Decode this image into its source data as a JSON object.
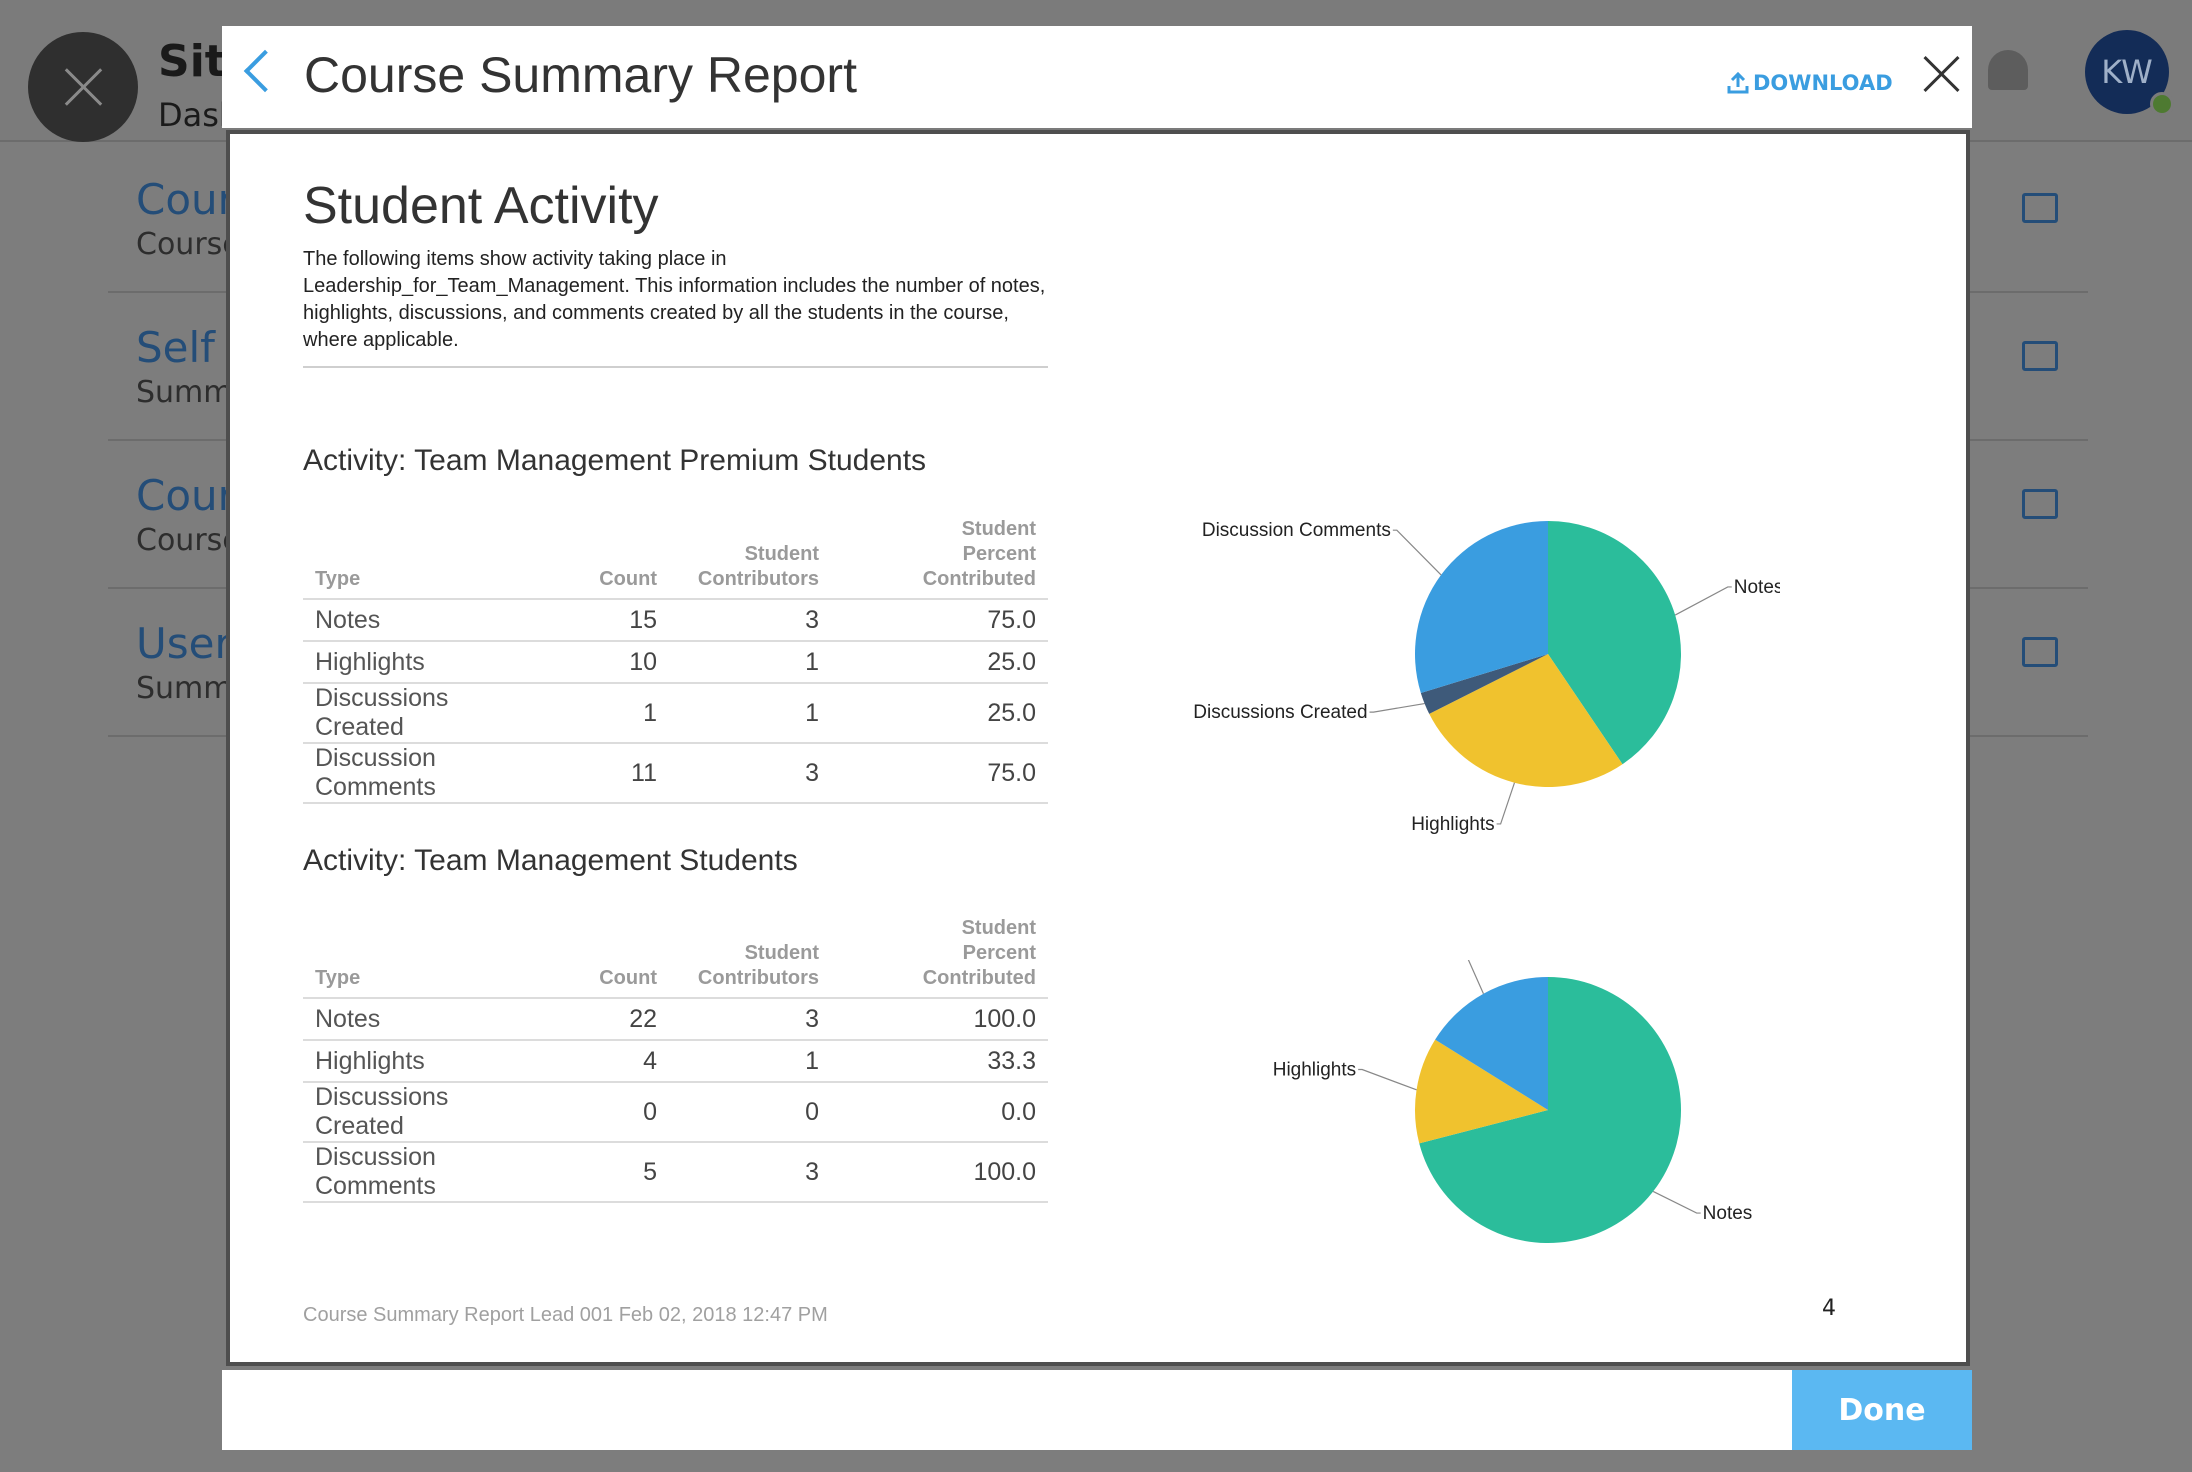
{
  "background": {
    "header_title": "Site",
    "header_subtitle": "Dash",
    "avatar_initials": "KW",
    "rows": [
      {
        "title": "Cour",
        "subtitle": "Course"
      },
      {
        "title": "Self /",
        "subtitle": "Summ"
      },
      {
        "title": "Cour",
        "subtitle": "Course"
      },
      {
        "title": "User",
        "subtitle": "Summ"
      }
    ]
  },
  "modal": {
    "title": "Course Summary Report",
    "download_label": "DOWNLOAD",
    "done_label": "Done"
  },
  "report": {
    "section_title": "Student Activity",
    "intro": "The following items show activity taking place in Leadership_for_Team_Management. This information includes the number of notes, highlights, discussions, and comments created by all the students in the course, where applicable.",
    "footer": "Course Summary Report Lead 001 Feb 02, 2018 12:47 PM",
    "page_number": "4",
    "columns": {
      "type": "Type",
      "count": "Count",
      "contributors_l1": "Student",
      "contributors_l2": "Contributors",
      "percent_l1": "Student",
      "percent_l2": "Percent",
      "percent_l3": "Contributed"
    },
    "tables": [
      {
        "title": "Activity: Team Management Premium Students",
        "rows": [
          {
            "type": "Notes",
            "count": "15",
            "contributors": "3",
            "percent": "75.0"
          },
          {
            "type": "Highlights",
            "count": "10",
            "contributors": "1",
            "percent": "25.0"
          },
          {
            "type": "Discussions Created",
            "count": "1",
            "contributors": "1",
            "percent": "25.0"
          },
          {
            "type": "Discussion Comments",
            "count": "11",
            "contributors": "3",
            "percent": "75.0"
          }
        ]
      },
      {
        "title": "Activity: Team Management Students",
        "rows": [
          {
            "type": "Notes",
            "count": "22",
            "contributors": "3",
            "percent": "100.0"
          },
          {
            "type": "Highlights",
            "count": "4",
            "contributors": "1",
            "percent": "33.3"
          },
          {
            "type": "Discussions Created",
            "count": "0",
            "contributors": "0",
            "percent": "0.0"
          },
          {
            "type": "Discussion Comments",
            "count": "5",
            "contributors": "3",
            "percent": "100.0"
          }
        ]
      }
    ]
  },
  "colors": {
    "notes": "#2bbd9b",
    "highlights": "#f0c22e",
    "discussions_created": "#3e5a7a",
    "discussion_comments": "#3a9de0",
    "accent": "#3a9de0",
    "done_button": "#5bb8f2"
  },
  "icons": [
    "back-chevron-icon",
    "upload-icon",
    "close-icon",
    "bell-icon",
    "external-link-icon"
  ],
  "chart_data": [
    {
      "type": "pie",
      "labels": [
        "Notes",
        "Highlights",
        "Discussions Created",
        "Discussion Comments"
      ],
      "values": [
        15,
        10,
        1,
        11
      ]
    },
    {
      "type": "pie",
      "labels": [
        "Notes",
        "Highlights",
        "Discussions Created",
        "Discussion Comments"
      ],
      "values": [
        22,
        4,
        0,
        5
      ]
    }
  ]
}
